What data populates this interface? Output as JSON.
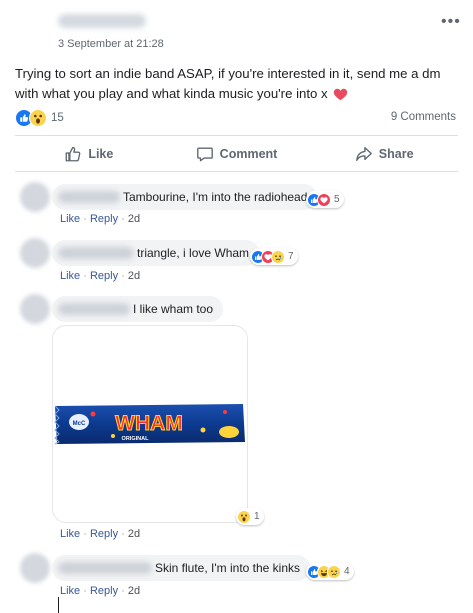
{
  "post": {
    "timestamp": "3 September at 21:28",
    "text": "Trying to sort an indie band ASAP, if you're interested in it, send me a dm with what you play and what kinda music you're into x",
    "reaction_count": "15",
    "comment_count": "9 Comments",
    "reaction_icons": [
      "like-icon",
      "wow-icon"
    ],
    "more_glyph": "•••"
  },
  "actions": {
    "like": "Like",
    "comment": "Comment",
    "share": "Share"
  },
  "comments": [
    {
      "text": "Tambourine, I'm into the radiohead",
      "reactions": [
        "like-icon",
        "love-icon"
      ],
      "reaction_count": "5",
      "like_label": "Like",
      "reply_label": "Reply",
      "time": "2d"
    },
    {
      "text": "triangle, i love Wham",
      "reactions": [
        "like-icon",
        "love-icon",
        "sad-icon"
      ],
      "reaction_count": "7",
      "like_label": "Like",
      "reply_label": "Reply",
      "time": "2d"
    },
    {
      "text": "I like wham too",
      "sticker": "Wham chocolate bar",
      "sticker_text": "WHAM",
      "sticker_sub": "ORIGINAL",
      "reactions": [
        "wow-icon"
      ],
      "reaction_count": "1",
      "like_label": "Like",
      "reply_label": "Reply",
      "time": "2d"
    },
    {
      "text": "Skin flute, I'm into the kinks",
      "reactions": [
        "like-icon",
        "haha-icon",
        "sad-icon"
      ],
      "reaction_count": "4",
      "like_label": "Like",
      "reply_label": "Reply",
      "time": "2d"
    }
  ],
  "colors": {
    "like_blue": "#1877f2",
    "love_red": "#f33e58",
    "emoji_yellow": "#fcd34d",
    "link": "#385898",
    "bubble": "#f2f3f5"
  }
}
